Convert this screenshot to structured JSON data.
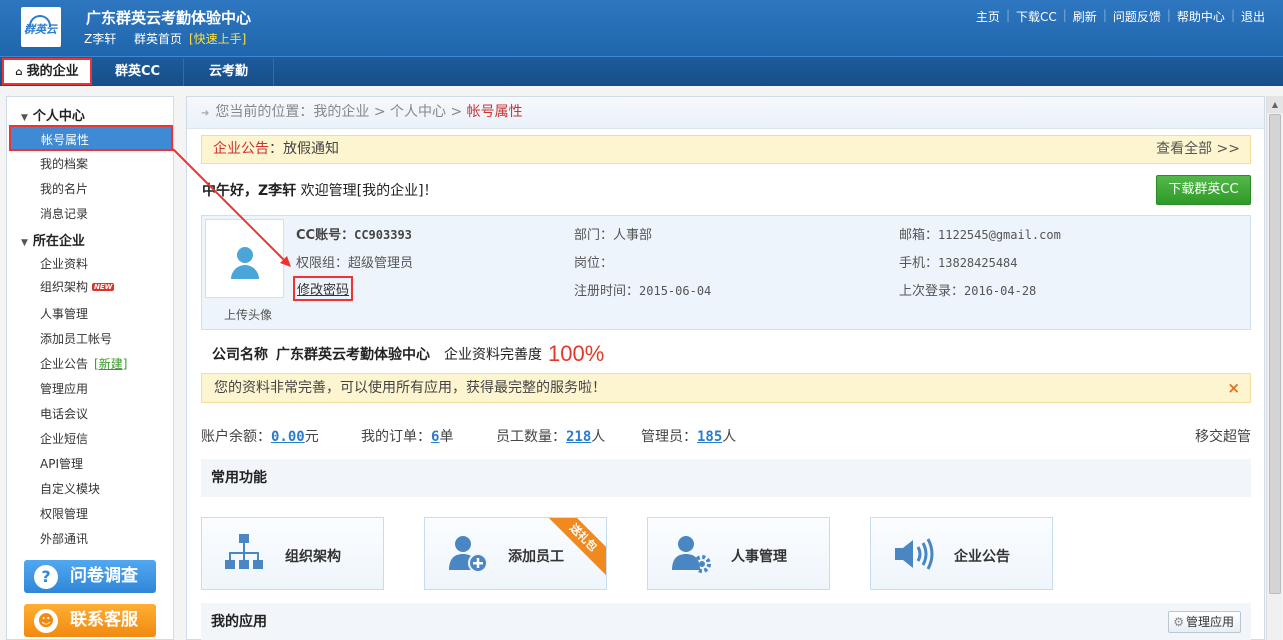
{
  "header": {
    "logo_text": "群英云",
    "site_title": "广东群英云考勤体验中心",
    "user_name": "Z李轩",
    "home_link": "群英首页",
    "quick_start": "[快速上手]",
    "links": [
      "主页",
      "下载CC",
      "刷新",
      "问题反馈",
      "帮助中心",
      "退出"
    ]
  },
  "nav": {
    "tabs": [
      "我的企业",
      "群英CC",
      "云考勤"
    ]
  },
  "sidebar": {
    "section_personal": "个人中心",
    "personal_items": [
      "帐号属性",
      "我的档案",
      "我的名片",
      "消息记录"
    ],
    "section_company": "所在企业",
    "company_items": [
      "企业资料",
      "组织架构",
      "人事管理",
      "添加员工帐号",
      "企业公告",
      "管理应用",
      "电话会议",
      "企业短信",
      "API管理",
      "自定义模块",
      "权限管理",
      "外部通讯"
    ],
    "new_badge": "NEW",
    "new_link": "[新建]",
    "survey_button": "问卷调查",
    "support_button": "联系客服"
  },
  "breadcrumb": {
    "prefix": "您当前的位置：",
    "path": [
      "我的企业",
      "个人中心"
    ],
    "current": "帐号属性",
    "separator": ">"
  },
  "notice": {
    "label": "企业公告",
    "text": "放假通知",
    "view_all": "查看全部 >>"
  },
  "greeting": {
    "prefix": "中午好，",
    "name": "Z李轩",
    "suffix": " 欢迎管理[我的企业]！"
  },
  "download_button": "下载群英CC",
  "profile": {
    "upload_avatar": "上传头像",
    "cc_account_label": "CC账号：",
    "cc_account": "CC903393",
    "role_label": "权限组：",
    "role": "超级管理员",
    "change_password": "修改密码",
    "dept_label": "部门：",
    "dept": "人事部",
    "position_label": "岗位：",
    "position": "",
    "register_label": "注册时间：",
    "register_date": "2015-06-04",
    "email_label": "邮箱：",
    "email": "1122545@gmail.com",
    "phone_label": "手机：",
    "phone": "13828425484",
    "last_login_label": "上次登录：",
    "last_login": "2016-04-28"
  },
  "company": {
    "name_label": "公司名称",
    "name": "广东群英云考勤体验中心",
    "completeness_label": "企业资料完善度",
    "completeness": "100%"
  },
  "tip": {
    "text": "您的资料非常完善，可以使用所有应用，获得最完整的服务啦！",
    "close": "×"
  },
  "stats": {
    "balance_label": "账户余额：",
    "balance": "0.00",
    "balance_unit": "元",
    "orders_label": "我的订单：",
    "orders": "6",
    "orders_unit": "单",
    "employees_label": "员工数量：",
    "employees": "218",
    "employees_unit": "人",
    "admins_label": "管理员：",
    "admins": "185",
    "admins_unit": "人",
    "transfer": "移交超管"
  },
  "common_functions": {
    "title": "常用功能",
    "cards": [
      "组织架构",
      "添加员工",
      "人事管理",
      "企业公告"
    ],
    "ribbon": "送礼包"
  },
  "my_apps": {
    "title": "我的应用",
    "manage_button": "管理应用"
  },
  "colors": {
    "header_blue": "#2e76bf",
    "highlight_red": "#e33333",
    "link_blue": "#2a7ccc",
    "download_green": "#2f9a28",
    "survey_blue": "#2f87d8",
    "support_orange": "#f18a0f"
  }
}
